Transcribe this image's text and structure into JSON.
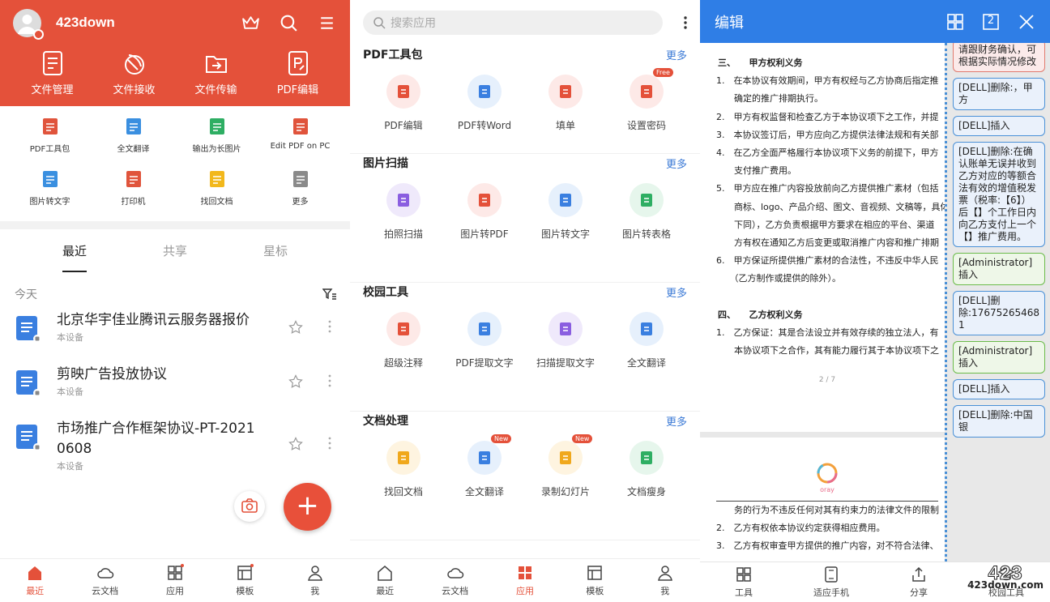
{
  "left": {
    "username": "423down",
    "quick": [
      {
        "label": "文件管理",
        "icon": "file-manage-icon"
      },
      {
        "label": "文件接收",
        "icon": "file-receive-icon"
      },
      {
        "label": "文件传输",
        "icon": "file-transfer-icon"
      },
      {
        "label": "PDF编辑",
        "icon": "pdf-edit-icon"
      }
    ],
    "tools": [
      {
        "label": "PDF工具包",
        "icon": "pdf-toolkit-icon",
        "color": "#e0543c"
      },
      {
        "label": "全文翻译",
        "icon": "translate-icon",
        "color": "#3a8fe0"
      },
      {
        "label": "输出为长图片",
        "icon": "long-image-icon",
        "color": "#2eae63"
      },
      {
        "label": "Edit PDF on PC",
        "icon": "pc-pdf-icon",
        "color": "#e0543c"
      },
      {
        "label": "图片转文字",
        "icon": "image-text-icon",
        "color": "#3a8fe0"
      },
      {
        "label": "打印机",
        "icon": "printer-icon",
        "color": "#e0543c"
      },
      {
        "label": "找回文档",
        "icon": "recover-icon",
        "color": "#f2b81c"
      },
      {
        "label": "更多",
        "icon": "more-grid-icon",
        "color": "#8a8a8a"
      }
    ],
    "tabs": [
      "最近",
      "共享",
      "星标"
    ],
    "today": "今天",
    "files": [
      {
        "name": "北京华宇佳业腾讯云服务器报价",
        "sub": "本设备"
      },
      {
        "name": "剪映广告投放协议",
        "sub": "本设备"
      },
      {
        "name": "市场推广合作框架协议-PT-20210608",
        "sub": "本设备"
      }
    ],
    "bottom": [
      "最近",
      "云文档",
      "应用",
      "模板",
      "我"
    ]
  },
  "middle": {
    "search_placeholder": "搜索应用",
    "more": "更多",
    "sections": [
      {
        "title": "PDF工具包",
        "apps": [
          {
            "label": "PDF编辑",
            "bg": "#fde9e7",
            "fg": "#e4513a"
          },
          {
            "label": "PDF转Word",
            "bg": "#e6f0fc",
            "fg": "#3a7fe0"
          },
          {
            "label": "填单",
            "bg": "#fde9e7",
            "fg": "#e4513a"
          },
          {
            "label": "设置密码",
            "bg": "#fde9e7",
            "fg": "#e4513a",
            "tag": "Free"
          }
        ]
      },
      {
        "title": "图片扫描",
        "apps": [
          {
            "label": "拍照扫描",
            "bg": "#efe9fb",
            "fg": "#8a5ee0"
          },
          {
            "label": "图片转PDF",
            "bg": "#fde9e7",
            "fg": "#e4513a"
          },
          {
            "label": "图片转文字",
            "bg": "#e6f0fc",
            "fg": "#3a7fe0"
          },
          {
            "label": "图片转表格",
            "bg": "#e6f6ec",
            "fg": "#2eae63"
          }
        ]
      },
      {
        "title": "校园工具",
        "apps": [
          {
            "label": "超级注释",
            "bg": "#fde9e7",
            "fg": "#e4513a"
          },
          {
            "label": "PDF提取文字",
            "bg": "#e6f0fc",
            "fg": "#3a7fe0"
          },
          {
            "label": "扫描提取文字",
            "bg": "#efe9fb",
            "fg": "#8a5ee0"
          },
          {
            "label": "全文翻译",
            "bg": "#e6f0fc",
            "fg": "#3a7fe0"
          }
        ]
      },
      {
        "title": "文档处理",
        "apps": [
          {
            "label": "找回文档",
            "bg": "#fef4e0",
            "fg": "#f0a81c"
          },
          {
            "label": "全文翻译",
            "bg": "#e6f0fc",
            "fg": "#3a7fe0",
            "tag": "New"
          },
          {
            "label": "录制幻灯片",
            "bg": "#fef4e0",
            "fg": "#f0a81c",
            "tag": "New"
          },
          {
            "label": "文档瘦身",
            "bg": "#e6f6ec",
            "fg": "#2eae63"
          }
        ]
      }
    ],
    "bottom": [
      "最近",
      "云文档",
      "应用",
      "模板",
      "我"
    ]
  },
  "right": {
    "title": "编辑",
    "badge": "2",
    "doc_lines": [
      "三、　　甲方权利义务",
      "1.　在本协议有效期间，甲方有权经与乙方协商后指定推",
      "　　确定的推广排期执行。",
      "2.　甲方有权监督和检查乙方于本协议项下之工作，并提",
      "3.　本协议签订后，甲方应向乙方提供法律法规和有关部",
      "4.　在乙方全面严格履行本协议项下义务的前提下，甲方",
      "　　支付推广费用。",
      "5.　甲方应在推广内容投放前向乙方提供推广素材（包括",
      "　　商标、logo、产品介绍、图文、音视频、文稿等，具体",
      "　　下同），乙方负责根据甲方要求在相应的平台、渠道",
      "　　方有权在通知乙方后变更或取消推广内容和推广排期",
      "6.　甲方保证所提供推广素材的合法性，不违反中华人民",
      "　　（乙方制作或提供的除外）。",
      "",
      "四、　　乙方权利义务",
      "1.　乙方保证：其是合法设立并有效存续的独立法人，有",
      "　　本协议项下之合作，其有能力履行其于本协议项下之"
    ],
    "page_num": "2 / 7",
    "logo_text": "oray",
    "doc2_lines": [
      "　　务的行为不违反任何对其有约束力的法律文件的限制",
      "2.　乙方有权依本协议约定获得相应费用。",
      "3.　乙方有权审查甲方提供的推广内容，对不符合法律、"
    ],
    "comments": [
      {
        "text": "请跟财务确认，可根据实际情况修改",
        "kind": "r"
      },
      {
        "text": "[DELL]删除:，甲方",
        "kind": "b"
      },
      {
        "text": "[DELL]插入",
        "kind": "b"
      },
      {
        "text": "[DELL]删除:在确认账单无误并收到乙方对应的等额合法有效的增值税发票（税率:【6】）后【】个工作日内向乙方支付上一个【】推广费用。",
        "kind": "b"
      },
      {
        "text": "[Administrator]插入",
        "kind": "g"
      },
      {
        "text": "[DELL]删除:17675265468 1",
        "kind": "b"
      },
      {
        "text": "[Administrator]插入",
        "kind": "g"
      },
      {
        "text": "[DELL]插入",
        "kind": "b"
      },
      {
        "text": "[DELL]删除:中国银",
        "kind": "b"
      }
    ],
    "bottom": [
      "工具",
      "适应手机",
      "分享",
      "校园工具"
    ],
    "watermark_big": "423",
    "watermark_small": "423down.com"
  }
}
